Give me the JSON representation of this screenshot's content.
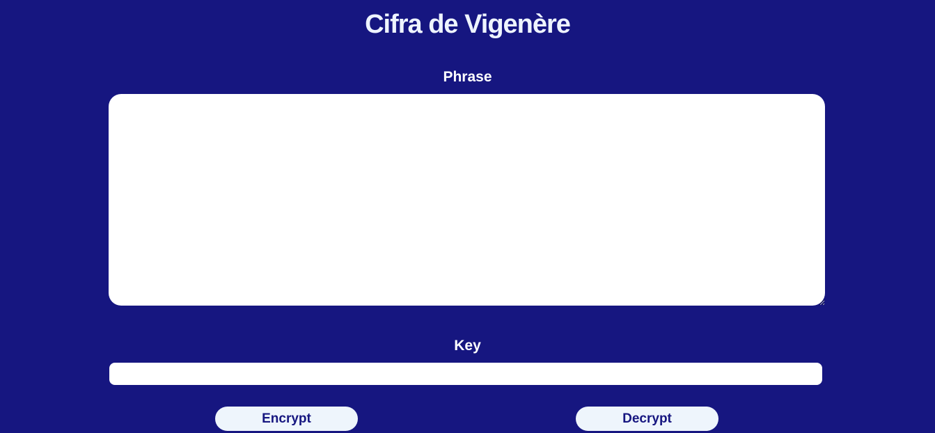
{
  "page": {
    "title": "Cifra de Vigenère"
  },
  "phrase": {
    "label": "Phrase",
    "value": "",
    "placeholder": ""
  },
  "key": {
    "label": "Key",
    "value": "",
    "placeholder": ""
  },
  "actions": {
    "encrypt_label": "Encrypt",
    "decrypt_label": "Decrypt"
  },
  "colors": {
    "background": "#161680",
    "button_background": "#eef5fc",
    "text_light": "#ffffff"
  }
}
